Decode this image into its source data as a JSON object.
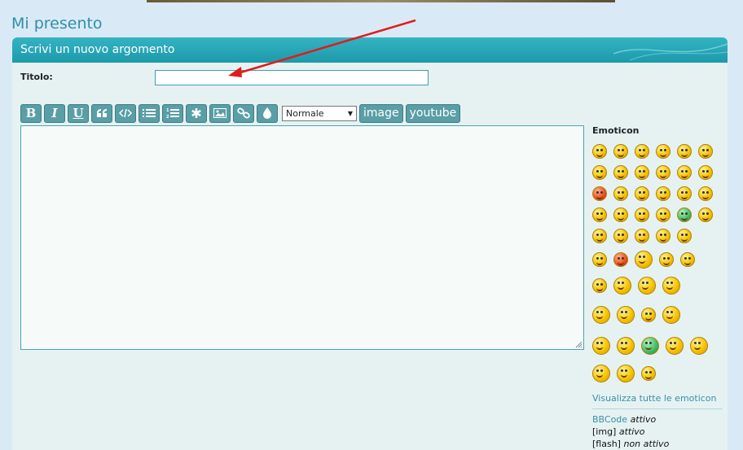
{
  "page": {
    "title": "Mi presento"
  },
  "panel": {
    "header": "Scrivi un nuovo argomento"
  },
  "form": {
    "title_label": "Titolo:",
    "title_value": ""
  },
  "toolbar": {
    "bold": "B",
    "italic": "I",
    "underline": "U",
    "font_size_selected": "Normale",
    "image_label": "image",
    "youtube_label": "youtube"
  },
  "emoticons": {
    "title": "Emoticon",
    "show_all": "Visualizza tutte le emoticon"
  },
  "bbcode": {
    "bbcode_label": "BBCode",
    "bbcode_state": "attivo",
    "img_label": "[img]",
    "img_state": "attivo",
    "flash_label": "[flash]",
    "flash_state": "non attivo"
  },
  "colors": {
    "header": "#1c9aaa",
    "button": "#5a9ea6",
    "annotation_arrow": "#e01b1b"
  }
}
